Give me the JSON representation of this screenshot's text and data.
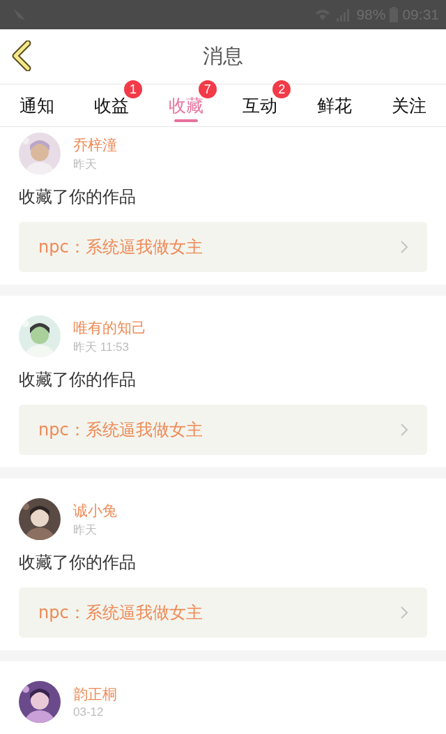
{
  "status_bar": {
    "battery": "98%",
    "time": "09:31"
  },
  "header": {
    "title": "消息"
  },
  "tabs": [
    {
      "label": "通知",
      "selected": false
    },
    {
      "label": "收益",
      "selected": false,
      "badge": "1"
    },
    {
      "label": "收藏",
      "selected": true,
      "badge": "7"
    },
    {
      "label": "互动",
      "selected": false,
      "badge": "2"
    },
    {
      "label": "鲜花",
      "selected": false
    },
    {
      "label": "关注",
      "selected": false
    }
  ],
  "messages": [
    {
      "name": "乔梓潼",
      "time": "昨天",
      "action": "收藏了你的作品",
      "work": "npc：系统逼我做女主"
    },
    {
      "name": "唯有的知己",
      "time": "昨天 11:53",
      "action": "收藏了你的作品",
      "work": "npc：系统逼我做女主"
    },
    {
      "name": "诚小兔",
      "time": "昨天",
      "action": "收藏了你的作品",
      "work": "npc：系统逼我做女主"
    },
    {
      "name": "韵正桐",
      "time": "03-12"
    }
  ]
}
